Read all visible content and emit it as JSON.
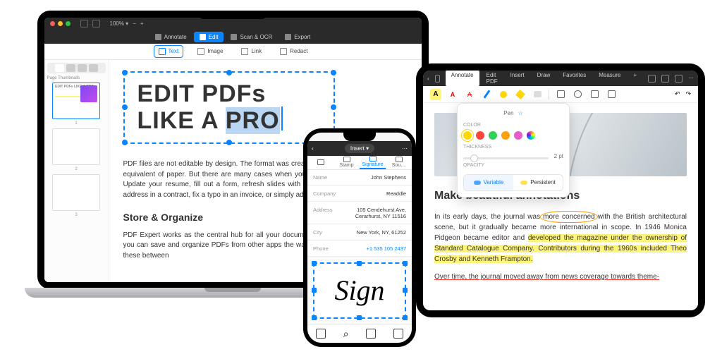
{
  "macbook": {
    "zoom": "100% ▾",
    "main_tabs": {
      "annotate": "Annotate",
      "edit": "Edit",
      "scan": "Scan & OCR",
      "export": "Export"
    },
    "sub_tabs": {
      "text": "Text",
      "image": "Image",
      "link": "Link",
      "redact": "Redact"
    },
    "side_title": "Page Thumbnails",
    "thumb1_title": "EDIT PDFs LIKE A PRO",
    "t1": "1",
    "t2": "2",
    "t3": "3",
    "doc_title_1": "EDIT PDFs",
    "doc_title_2a": "LIKE A ",
    "doc_title_2b": "PRO",
    "para1": "PDF files are not editable by design. The format was created a few decades ago as digital equivalent of paper. But there are many cases when you actually need to edit that PDF: Update your resume, fill out a form, refresh slides with relevant information, change the address in a contract, fix a typo in an invoice, or simply add a few zeros to a sum.",
    "h2": "Store & Organize",
    "para2": "PDF Expert works as the central hub for all your documents. Using PDF Expert for iOS, you can save and organize PDFs from other apps the way you want, including folders. All these between"
  },
  "iphone": {
    "insert_pill": "Insert ▾",
    "tabs": {
      "stamp": "Stamp",
      "signature": "Signature",
      "sou": "Sou…"
    },
    "rows": {
      "name_k": "Name",
      "name_v": "John Stephens",
      "company_k": "Company",
      "company_v": "Readdle",
      "address_k": "Address",
      "address_v": "105 Cendehurst Ave,\nCerarhurst, NY 11516",
      "city_k": "City",
      "city_v": "New York, NY, 61252",
      "phone_k": "Phone",
      "phone_v": "+1 535 105 2437"
    },
    "sign_text": "Sign"
  },
  "ipad": {
    "tabs": {
      "annotate": "Annotate",
      "edit": "Edit PDF",
      "insert": "Insert",
      "draw": "Draw",
      "fav": "Favorites",
      "measure": "Measure"
    },
    "pop": {
      "title": "Pen",
      "color_lbl": "COLOR",
      "colors": [
        "#ffd60a",
        "#ff453a",
        "#30d158",
        "#ff9f0a",
        "#e65cc8",
        "#a78bfa"
      ],
      "thick_lbl": "THICKNESS",
      "thick_val": "2 pt",
      "opacity_lbl": "OPACITY",
      "variable": "Variable",
      "persistent": "Persistent"
    },
    "h": "Make beautiful annotations",
    "p1a": "In its early days, the journal was ",
    "p1b": "more concerned",
    "p1c": " with the British architectural scene, but it gradually became more international in scope. In 1946 Monica Pidgeon became editor and ",
    "p1d": "developed the magazine under the ownership of Standard Catalogue Company. Contributors during the 1960s included Theo Crosby and Kenneth Frampton.",
    "p2": "Over time, the journal moved away from news coverage towards theme-"
  }
}
